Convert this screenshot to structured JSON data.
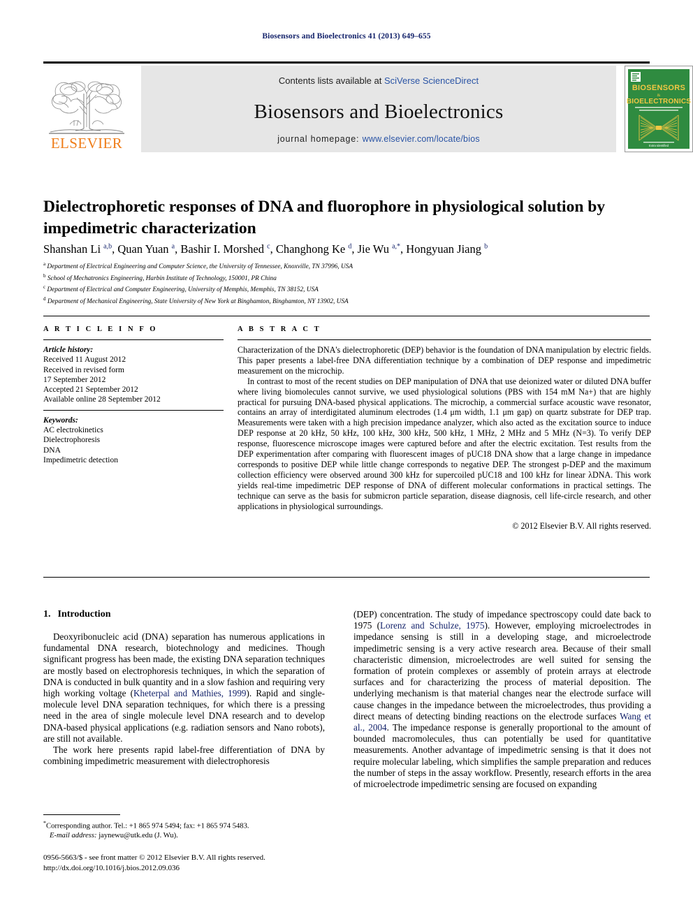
{
  "running_head": "Biosensors and Bioelectronics 41 (2013) 649–655",
  "masthead": {
    "contents_prefix": "Contents lists available at ",
    "contents_link": "SciVerse ScienceDirect",
    "journal_title": "Biosensors and Bioelectronics",
    "homepage_label": "journal homepage:",
    "homepage_url": "www.elsevier.com/locate/bios",
    "publisher": "ELSEVIER",
    "cover": {
      "line1": "BIOSENSORS",
      "amp": "&",
      "line2": "BIOELECTRONICS",
      "subtitle": "THE INTERNATIONAL JOURNAL OF BIOSENSORS AND BIOELECTRONICS",
      "footer": "Extra Identified"
    }
  },
  "article": {
    "title": "Dielectrophoretic responses of DNA and fluorophore in physiological solution by impedimetric characterization",
    "authors_html": "Shanshan Li <sup>a,b</sup>, Quan Yuan <sup>a</sup>, Bashir I. Morshed <sup>c</sup>, Changhong Ke <sup>d</sup>, Jie Wu <sup>a,*</sup>, Hongyuan Jiang <sup>b</sup>",
    "affiliations": [
      {
        "marker": "a",
        "text": "Department of Electrical Engineering and Computer Science, the University of Tennessee, Knoxville, TN 37996, USA"
      },
      {
        "marker": "b",
        "text": "School of Mechatronics Engineering, Harbin Institute of Technology, 150001, PR China"
      },
      {
        "marker": "c",
        "text": "Department of Electrical and Computer Engineering, University of Memphis, Memphis, TN 38152, USA"
      },
      {
        "marker": "d",
        "text": "Department of Mechanical Engineering, State University of New York at Binghamton, Binghamton, NY 13902, USA"
      }
    ]
  },
  "article_info": {
    "heading": "A R T I C L E   I N F O",
    "history_label": "Article history:",
    "history": [
      "Received 11 August 2012",
      "Received in revised form",
      "17 September 2012",
      "Accepted 21 September 2012",
      "Available online 28 September 2012"
    ],
    "keywords_label": "Keywords:",
    "keywords": [
      "AC electrokinetics",
      "Dielectrophoresis",
      "DNA",
      "Impedimetric detection"
    ]
  },
  "abstract": {
    "heading": "A B S T R A C T",
    "paragraph1": "Characterization of the DNA's dielectrophoretic (DEP) behavior is the foundation of DNA manipulation by electric fields. This paper presents a label-free DNA differentiation technique by a combination of DEP response and impedimetric measurement on the microchip.",
    "paragraph2": "In contrast to most of the recent studies on DEP manipulation of DNA that use deionized water or diluted DNA buffer where living biomolecules cannot survive, we used physiological solutions (PBS with 154 mM Na+) that are highly practical for pursuing DNA-based physical applications. The microchip, a commercial surface acoustic wave resonator, contains an array of interdigitated aluminum electrodes (1.4 μm width, 1.1 μm gap) on quartz substrate for DEP trap. Measurements were taken with a high precision impedance analyzer, which also acted as the excitation source to induce DEP response at 20 kHz, 50 kHz, 100 kHz, 300 kHz, 500 kHz, 1 MHz, 2 MHz and 5 MHz (N=3). To verify DEP response, fluorescence microscope images were captured before and after the electric excitation. Test results from the DEP experimentation after comparing with fluorescent images of pUC18 DNA show that a large change in impedance corresponds to positive DEP while little change corresponds to negative DEP. The strongest p-DEP and the maximum collection efficiency were observed around 300 kHz for supercoiled pUC18 and 100 kHz for linear λDNA. This work yields real-time impedimetric DEP response of DNA of different molecular conformations in practical settings. The technique can serve as the basis for submicron particle separation, disease diagnosis, cell life-circle research, and other applications in physiological surroundings.",
    "copyright": "© 2012 Elsevier B.V. All rights reserved."
  },
  "body": {
    "section_number": "1.",
    "section_title": "Introduction",
    "left_p1": "Deoxyribonucleic acid (DNA) separation has numerous applications in fundamental DNA research, biotechnology and medicines. Though significant progress has been made, the existing DNA separation techniques are mostly based on electrophoresis techniques, in which the separation of DNA is conducted in bulk quantity and in a slow fashion and requiring very high working voltage (",
    "left_p1_ref": "Kheterpal and Mathies, 1999",
    "left_p1_cont": "). Rapid and single-molecule level DNA separation techniques, for which there is a pressing need in the area of single molecule level DNA research and to develop DNA-based physical applications (e.g. radiation sensors and Nano robots), are still not available.",
    "left_p2": "The work here presents rapid label-free differentiation of DNA by combining impedimetric measurement with dielectrophoresis",
    "right_p1_start": "(DEP) concentration. The study of impedance spectroscopy could date back to 1975 (",
    "right_ref1": "Lorenz and Schulze, 1975",
    "right_p1_mid": "). However, employing microelectrodes in impedance sensing is still in a developing stage, and microelectrode impedimetric sensing is a very active research area. Because of their small characteristic dimension, microelectrodes are well suited for sensing the formation of protein complexes or assembly of protein arrays at electrode surfaces and for characterizing the process of material deposition. The underlying mechanism is that material changes near the electrode surface will cause changes in the impedance between the microelectrodes, thus providing a direct means of detecting binding reactions on the electrode surfaces ",
    "right_ref2": "Wang et al., 2004",
    "right_p1_end": ". The impedance response is generally proportional to the amount of bounded macromolecules, thus can potentially be used for quantitative measurements. Another advantage of impedimetric sensing is that it does not require molecular labeling, which simplifies the sample preparation and reduces the number of steps in the assay workflow. Presently, research efforts in the area of microelectrode impedimetric sensing are focused on expanding"
  },
  "footnotes": {
    "corresponding": "Corresponding author. Tel.: +1 865 974 5494; fax: +1 865 974 5483.",
    "email_label": "E-mail address:",
    "email_value": "jaynewu@utk.edu (J. Wu).",
    "issn_line": "0956-5663/$ - see front matter © 2012 Elsevier B.V. All rights reserved.",
    "doi_line": "http://dx.doi.org/10.1016/j.bios.2012.09.036"
  },
  "colors": {
    "link_blue": "#2a54a5",
    "ref_blue": "#14236b",
    "elsevier_orange": "#ef7d19",
    "cover_green": "#2f8b40",
    "band_gray": "#e6e6e6"
  }
}
